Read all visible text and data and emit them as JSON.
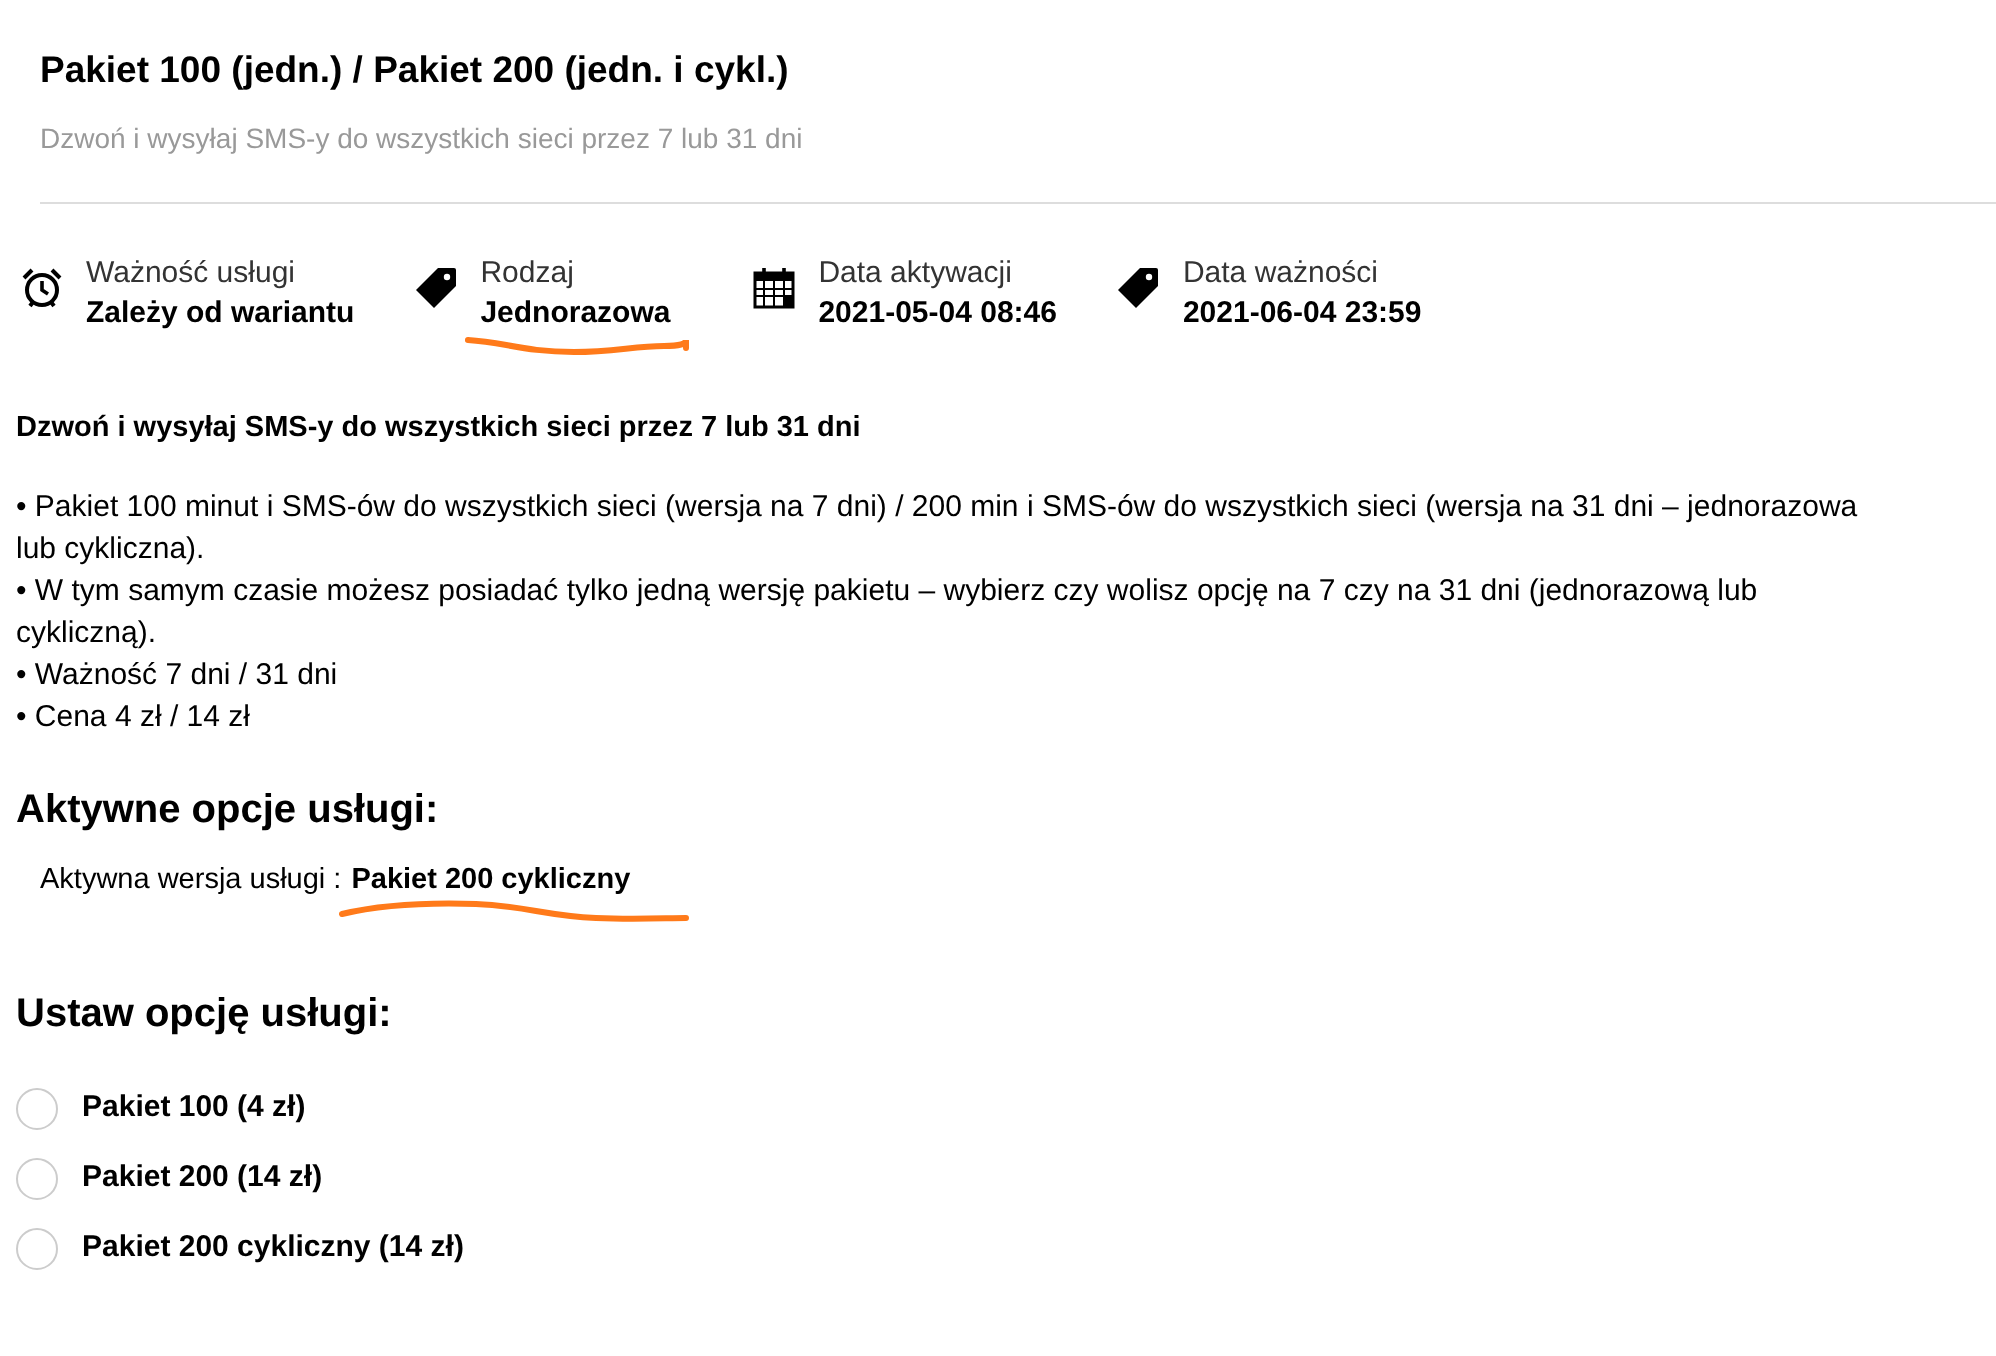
{
  "header": {
    "title": "Pakiet 100 (jedn.) / Pakiet 200 (jedn. i cykl.)",
    "subtitle": "Dzwoń i wysyłaj SMS-y do wszystkich sieci przez 7 lub 31 dni"
  },
  "info": [
    {
      "kind": "clock",
      "label": "Ważność usługi",
      "value": "Zależy od wariantu",
      "underlined": false
    },
    {
      "kind": "tag",
      "label": "Rodzaj",
      "value": "Jednorazowa",
      "underlined": true
    },
    {
      "kind": "calendar",
      "label": "Data aktywacji",
      "value": "2021-05-04 08:46",
      "underlined": false
    },
    {
      "kind": "tag",
      "label": "Data ważności",
      "value": "2021-06-04 23:59",
      "underlined": false
    }
  ],
  "description": {
    "heading": "Dzwoń i wysyłaj SMS-y do wszystkich sieci przez 7 lub 31 dni",
    "bullets": [
      "• Pakiet 100 minut i SMS-ów do wszystkich sieci (wersja na 7 dni) / 200 min i SMS-ów do wszystkich sieci (wersja na 31 dni – jednorazowa lub cykliczna).",
      "• W tym samym czasie możesz posiadać tylko jedną wersję pakietu – wybierz czy wolisz opcję na 7 czy na 31 dni (jednorazową lub cykliczną).",
      "• Ważność 7 dni / 31 dni",
      "• Cena 4 zł / 14 zł"
    ]
  },
  "active_options": {
    "heading": "Aktywne opcje usługi:",
    "label": "Aktywna wersja usługi :",
    "value": "Pakiet 200 cykliczny",
    "underlined": true
  },
  "set_option": {
    "heading": "Ustaw opcję usługi:",
    "options": [
      {
        "label": "Pakiet 100 (4 zł)",
        "selected": false
      },
      {
        "label": "Pakiet 200 (14 zł)",
        "selected": false
      },
      {
        "label": "Pakiet 200 cykliczny (14 zł)",
        "selected": false
      }
    ]
  }
}
